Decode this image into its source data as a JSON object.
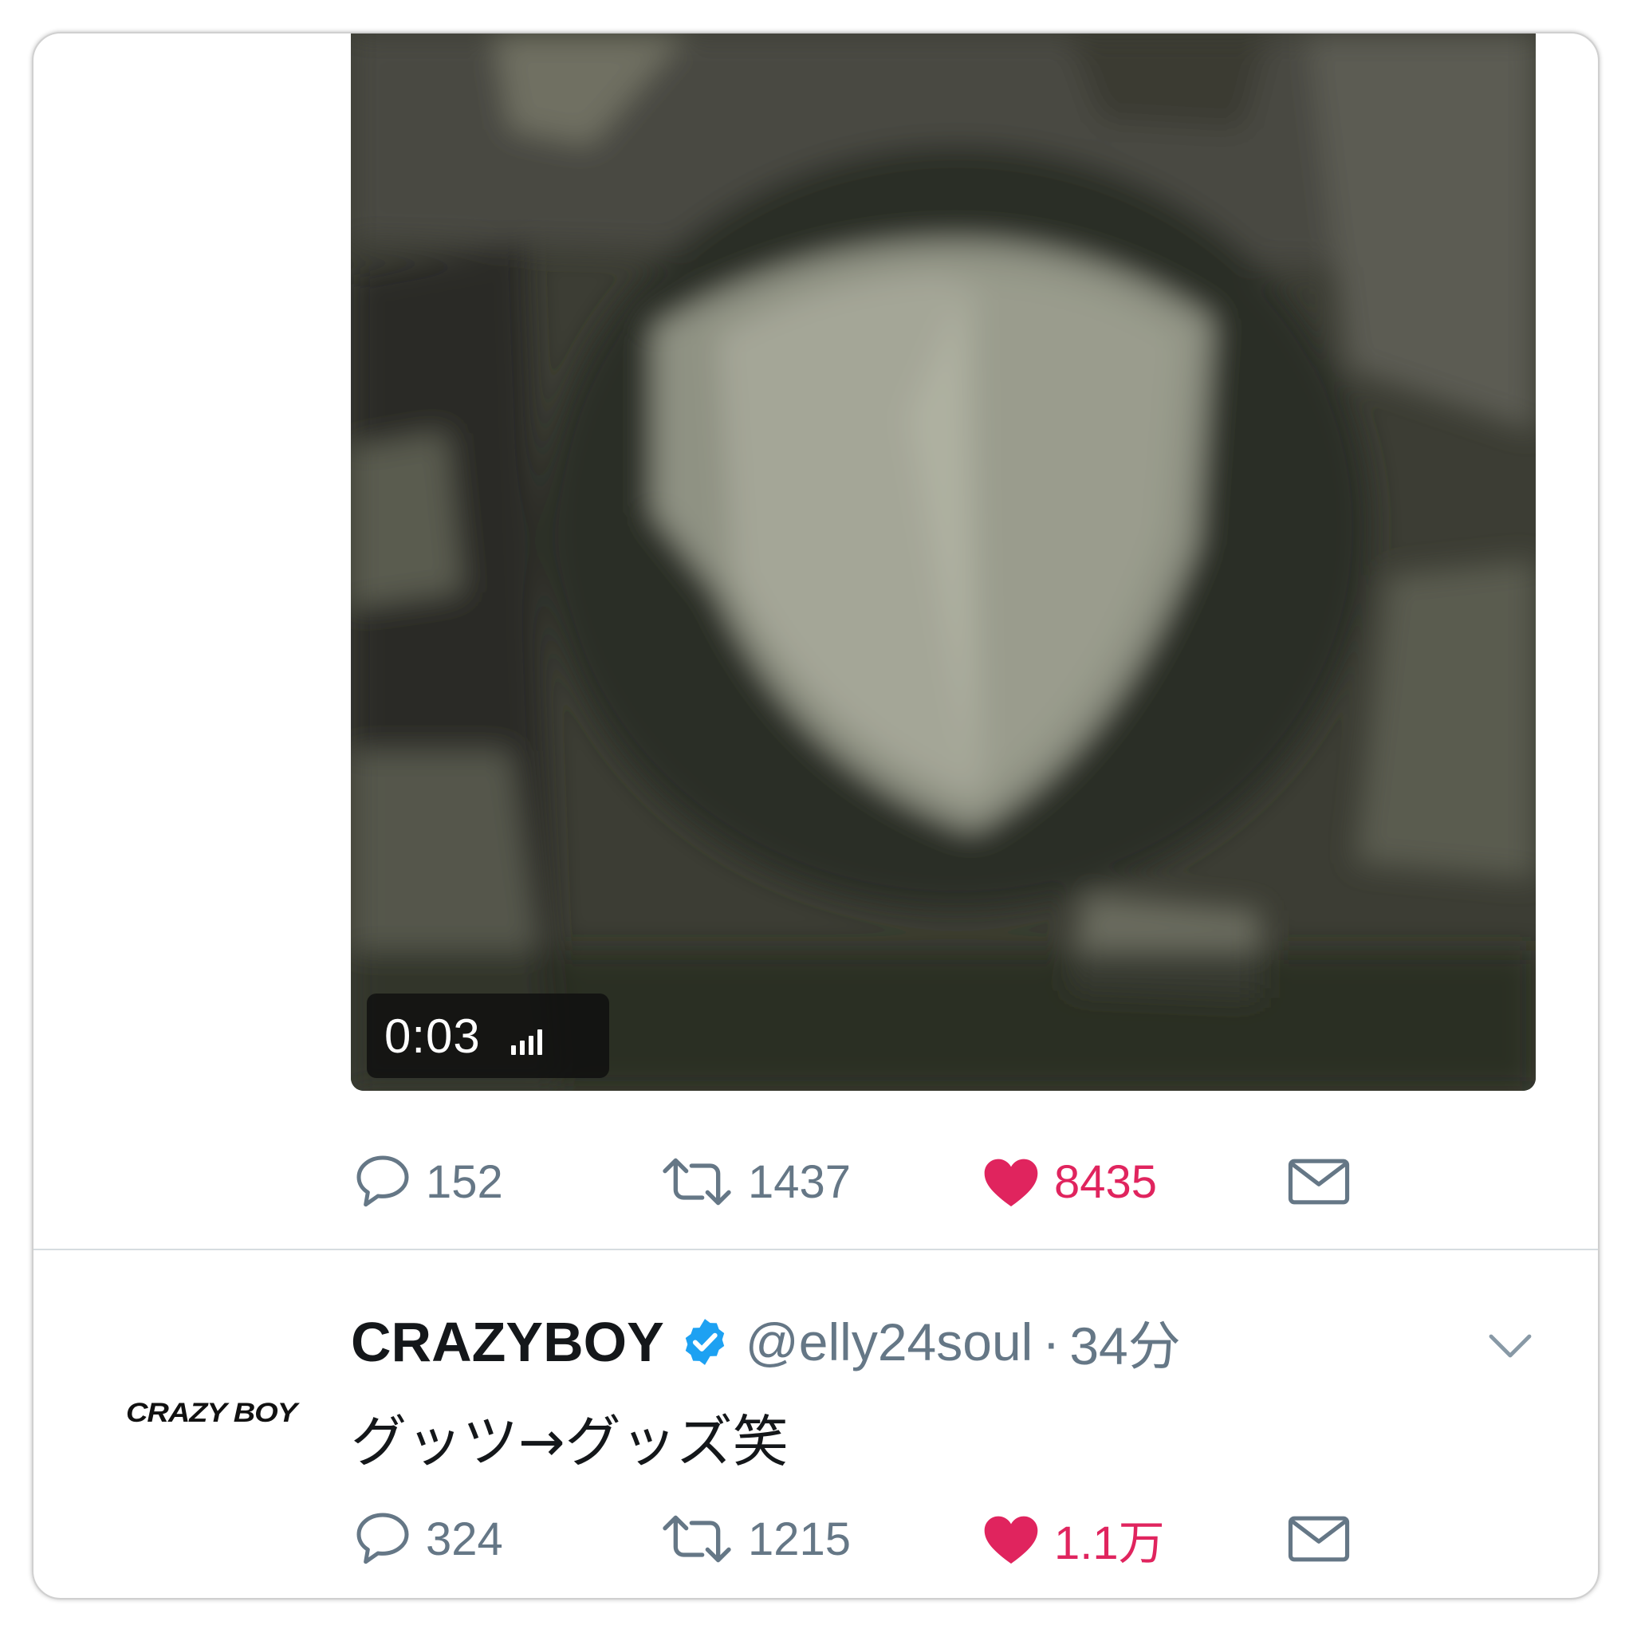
{
  "tweets": [
    {
      "media": {
        "video_time": "0:03",
        "icon": "volume-bars-icon"
      },
      "stats": {
        "replies": "152",
        "retweets": "1437",
        "likes": "8435",
        "liked": true
      }
    },
    {
      "author": {
        "display_name": "CRAZYBOY",
        "verified": true,
        "handle": "@elly24soul",
        "separator": "·",
        "time": "34分",
        "avatar_text": "CRAZY BOY"
      },
      "text": "グッツ→グッズ笑",
      "stats": {
        "replies": "324",
        "retweets": "1215",
        "likes": "1.1万",
        "liked": true
      }
    }
  ],
  "colors": {
    "like": "#e0245e",
    "muted": "#657786",
    "verified": "#1da1f2",
    "text": "#14171a"
  }
}
